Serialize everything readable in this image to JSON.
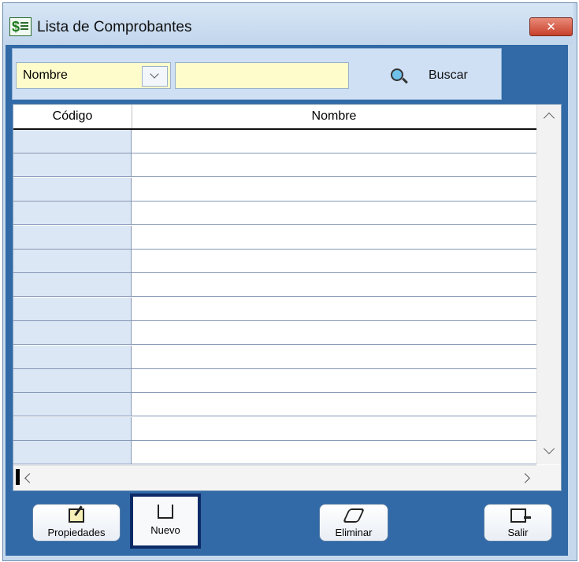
{
  "window": {
    "title": "Lista de Comprobantes",
    "close_label": "✕"
  },
  "search": {
    "field_selected": "Nombre",
    "query_value": "",
    "buscar_label": "Buscar"
  },
  "grid": {
    "columns": [
      "Código",
      "Nombre"
    ],
    "rows": [
      {
        "codigo": "",
        "nombre": ""
      },
      {
        "codigo": "",
        "nombre": ""
      },
      {
        "codigo": "",
        "nombre": ""
      },
      {
        "codigo": "",
        "nombre": ""
      },
      {
        "codigo": "",
        "nombre": ""
      },
      {
        "codigo": "",
        "nombre": ""
      },
      {
        "codigo": "",
        "nombre": ""
      },
      {
        "codigo": "",
        "nombre": ""
      },
      {
        "codigo": "",
        "nombre": ""
      },
      {
        "codigo": "",
        "nombre": ""
      },
      {
        "codigo": "",
        "nombre": ""
      },
      {
        "codigo": "",
        "nombre": ""
      },
      {
        "codigo": "",
        "nombre": ""
      },
      {
        "codigo": "",
        "nombre": ""
      }
    ]
  },
  "toolbar": {
    "propiedades_label": "Propiedades",
    "nuevo_label": "Nuevo",
    "eliminar_label": "Eliminar",
    "salir_label": "Salir"
  },
  "colors": {
    "client_background": "#316aa7",
    "input_background": "#fffccc",
    "code_column_background": "#dce7f6"
  }
}
